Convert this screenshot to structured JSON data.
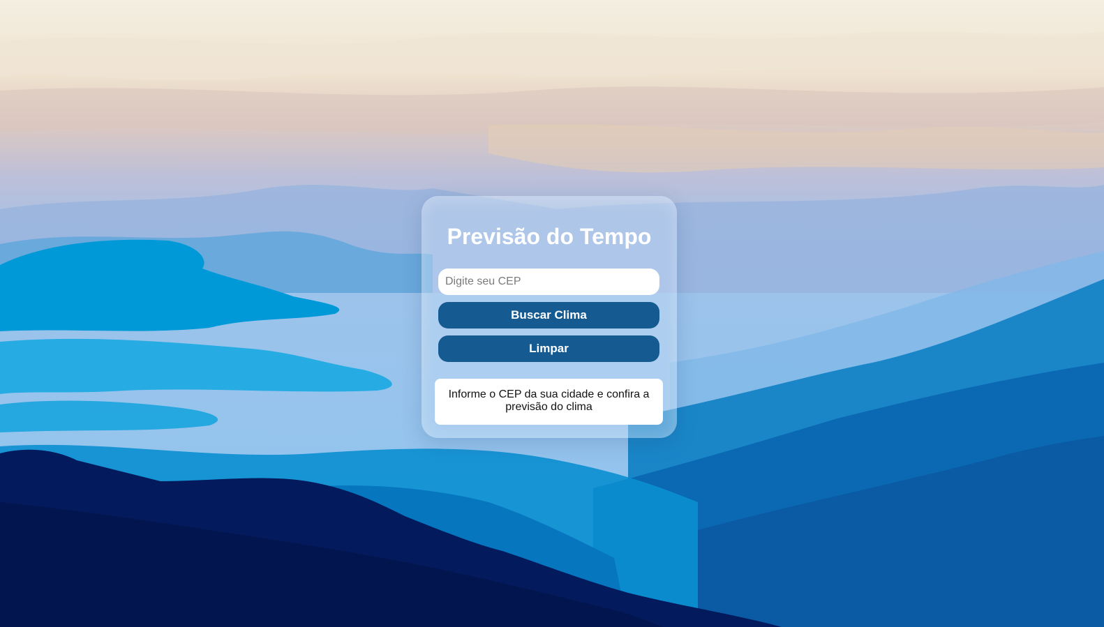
{
  "app": {
    "title": "Previsão do Tempo"
  },
  "form": {
    "cep_placeholder": "Digite seu CEP",
    "cep_value": "",
    "search_label": "Buscar Clima",
    "clear_label": "Limpar"
  },
  "result": {
    "message": "Informe o CEP da sua cidade e confira a previsão do clima"
  },
  "colors": {
    "button": "#155b92",
    "card": "rgba(200,222,245,0.42)",
    "text_light": "#ffffff"
  },
  "background": {
    "scene": "mountain-landscape"
  }
}
